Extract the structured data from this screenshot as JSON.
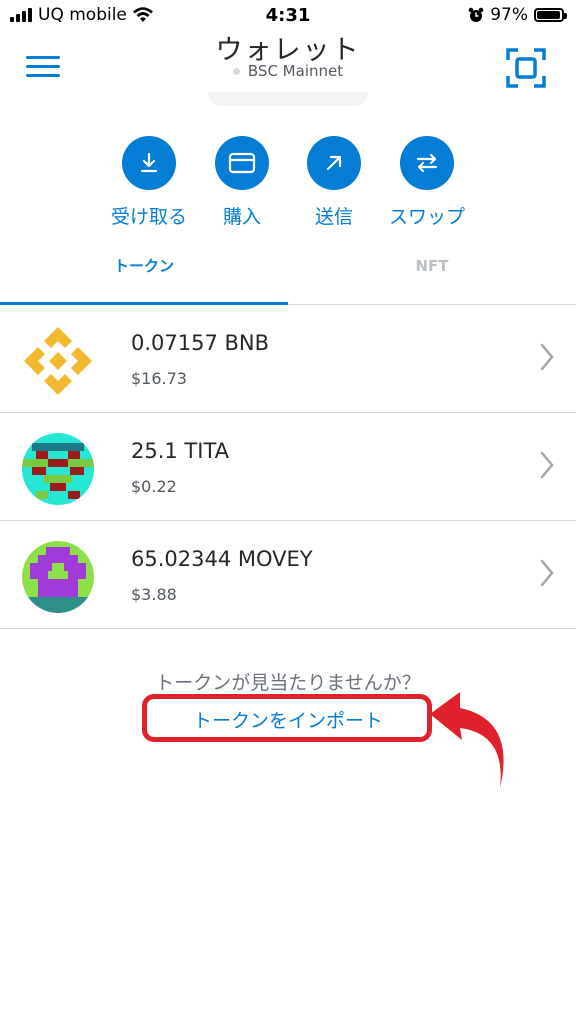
{
  "status_bar": {
    "carrier": "UQ mobile",
    "time": "4:31",
    "battery": "97%",
    "battery_level": 0.97
  },
  "header": {
    "title": "ウォレット",
    "network": "BSC Mainnet",
    "menu_icon": "hamburger-icon",
    "scan_icon": "scan-icon"
  },
  "actions": [
    {
      "label": "受け取る",
      "icon": "download-icon"
    },
    {
      "label": "購入",
      "icon": "card-icon"
    },
    {
      "label": "送信",
      "icon": "arrow-up-right-icon"
    },
    {
      "label": "スワップ",
      "icon": "swap-icon"
    }
  ],
  "tabs": [
    {
      "label": "トークン",
      "active": true
    },
    {
      "label": "NFT",
      "active": false
    }
  ],
  "tokens": [
    {
      "amount": "0.07157 BNB",
      "fiat": "$16.73",
      "icon": "bnb-icon"
    },
    {
      "amount": "25.1 TITA",
      "fiat": "$0.22",
      "icon": "tita-icon"
    },
    {
      "amount": "65.02344 MOVEY",
      "fiat": "$3.88",
      "icon": "movey-icon"
    }
  ],
  "footer": {
    "missing_text": "トークンが見当たりませんか？",
    "import_link": "トークンをインポート"
  },
  "colors": {
    "accent": "#037dd6",
    "highlight": "#e0202a",
    "bnb": "#f3ba2f"
  }
}
